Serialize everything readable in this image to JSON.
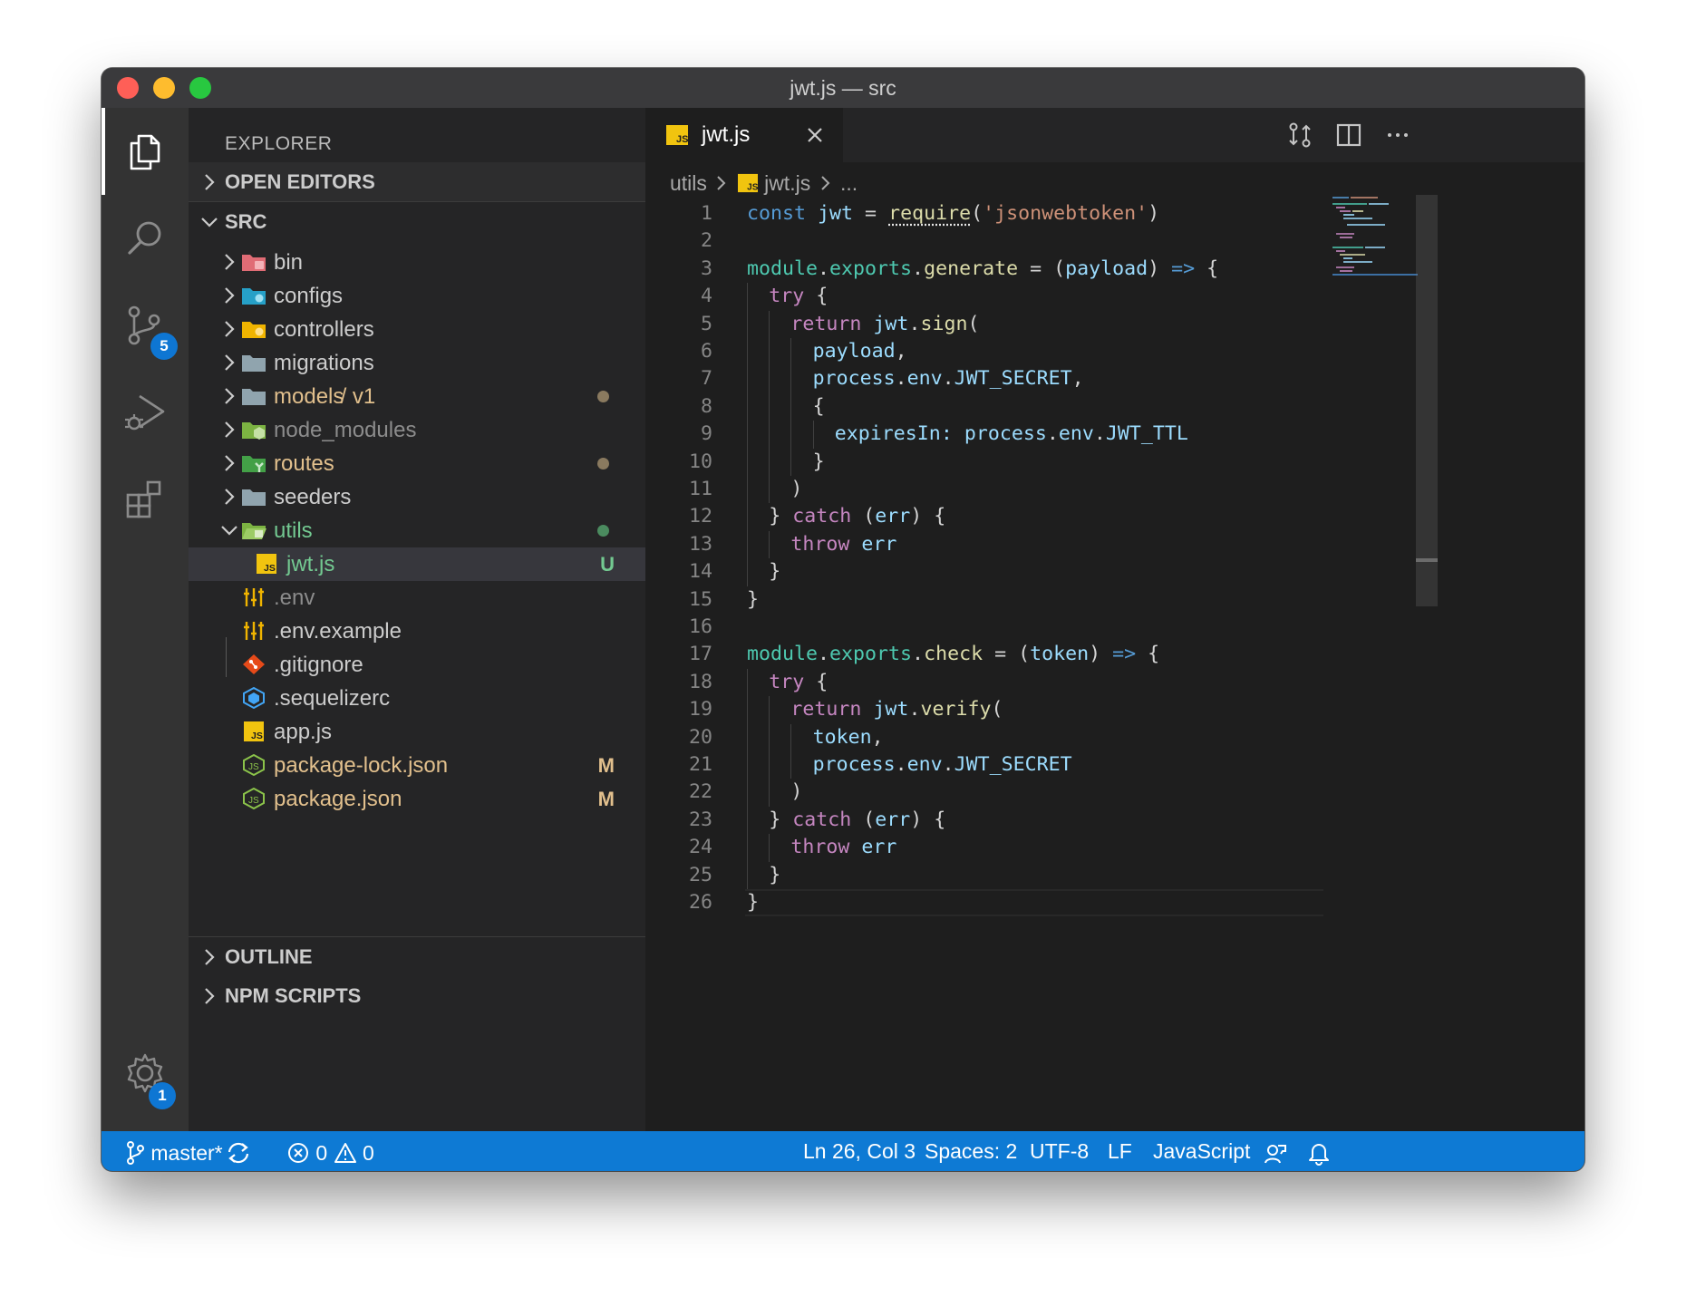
{
  "window": {
    "title": "jwt.js — src"
  },
  "activity_bar": {
    "items": [
      {
        "name": "explorer",
        "icon": "files-icon",
        "active": true
      },
      {
        "name": "search",
        "icon": "search-icon"
      },
      {
        "name": "source-control",
        "icon": "source-control-icon",
        "badge": "5"
      },
      {
        "name": "run-debug",
        "icon": "run-debug-icon"
      },
      {
        "name": "extensions",
        "icon": "extensions-icon"
      }
    ],
    "manage": {
      "icon": "gear-icon",
      "badge": "1"
    }
  },
  "sidebar": {
    "title": "EXPLORER",
    "sections": {
      "open_editors": "OPEN EDITORS",
      "src": "SRC",
      "outline": "OUTLINE",
      "npm_scripts": "NPM SCRIPTS"
    },
    "tree": [
      {
        "name": "bin",
        "kind": "folder",
        "icon": "folder-bin-icon",
        "color": "#cccccc"
      },
      {
        "name": "configs",
        "kind": "folder",
        "icon": "folder-config-icon",
        "color": "#cccccc"
      },
      {
        "name": "controllers",
        "kind": "folder",
        "icon": "folder-controller-icon",
        "color": "#cccccc"
      },
      {
        "name": "migrations",
        "kind": "folder",
        "icon": "folder-icon",
        "color": "#cccccc"
      },
      {
        "name": "models",
        "suffix": " / v1",
        "kind": "folder",
        "icon": "folder-icon",
        "color": "#e2c08d",
        "dot": "#8a7a5f"
      },
      {
        "name": "node_modules",
        "kind": "folder",
        "icon": "folder-node-icon",
        "color": "#8c8c8c"
      },
      {
        "name": "routes",
        "kind": "folder",
        "icon": "folder-routes-icon",
        "color": "#e2c08d",
        "dot": "#8a7a5f"
      },
      {
        "name": "seeders",
        "kind": "folder",
        "icon": "folder-icon",
        "color": "#cccccc"
      },
      {
        "name": "utils",
        "kind": "folder-open",
        "icon": "folder-utils-icon",
        "color": "#73c991",
        "dot": "#4b8b5f"
      },
      {
        "name": "jwt.js",
        "kind": "file",
        "icon": "js-file-icon",
        "color": "#73c991",
        "deco": "U",
        "deco_color": "#73c991",
        "selected": true
      },
      {
        "name": ".env",
        "kind": "file",
        "icon": "env-file-icon",
        "color": "#8c8c8c"
      },
      {
        "name": ".env.example",
        "kind": "file",
        "icon": "env-file-icon",
        "color": "#cccccc"
      },
      {
        "name": ".gitignore",
        "kind": "file",
        "icon": "git-file-icon",
        "color": "#cccccc"
      },
      {
        "name": ".sequelizerc",
        "kind": "file",
        "icon": "sequelize-file-icon",
        "color": "#cccccc"
      },
      {
        "name": "app.js",
        "kind": "file",
        "icon": "js-file-icon",
        "color": "#cccccc"
      },
      {
        "name": "package-lock.json",
        "kind": "file",
        "icon": "node-file-icon",
        "color": "#e2c08d",
        "deco": "M",
        "deco_color": "#e2c08d"
      },
      {
        "name": "package.json",
        "kind": "file",
        "icon": "node-file-icon",
        "color": "#e2c08d",
        "deco": "M",
        "deco_color": "#e2c08d"
      }
    ]
  },
  "editor": {
    "tab": {
      "label": "jwt.js",
      "icon": "js-file-icon",
      "close_icon": "close-icon"
    },
    "actions": [
      {
        "name": "open-changes",
        "icon": "compare-changes-icon"
      },
      {
        "name": "split-editor",
        "icon": "split-editor-icon"
      },
      {
        "name": "more-actions",
        "icon": "ellipsis-icon"
      }
    ],
    "breadcrumb": {
      "folder": "utils",
      "file": "jwt.js",
      "more": "..."
    },
    "cursor_line": 26,
    "lines": [
      {
        "n": "1",
        "indent": 0,
        "tokens": [
          [
            "kw",
            "const"
          ],
          [
            "pun",
            " "
          ],
          [
            "var",
            "jwt"
          ],
          [
            "pun",
            " = "
          ],
          [
            "fnw",
            "require"
          ],
          [
            "pun",
            "("
          ],
          [
            "str",
            "'jsonwebtoken'"
          ],
          [
            "pun",
            ")"
          ]
        ]
      },
      {
        "n": "2",
        "indent": 0,
        "tokens": []
      },
      {
        "n": "3",
        "indent": 0,
        "tokens": [
          [
            "obj",
            "module"
          ],
          [
            "pun",
            "."
          ],
          [
            "obj",
            "exports"
          ],
          [
            "pun",
            "."
          ],
          [
            "fn",
            "generate"
          ],
          [
            "pun",
            " = ("
          ],
          [
            "var",
            "payload"
          ],
          [
            "pun",
            ") "
          ],
          [
            "kw",
            "=>"
          ],
          [
            "pun",
            " {"
          ]
        ]
      },
      {
        "n": "4",
        "indent": 1,
        "tokens": [
          [
            "ctl",
            "try"
          ],
          [
            "pun",
            " {"
          ]
        ]
      },
      {
        "n": "5",
        "indent": 2,
        "tokens": [
          [
            "ctl",
            "return"
          ],
          [
            "pun",
            " "
          ],
          [
            "var",
            "jwt"
          ],
          [
            "pun",
            "."
          ],
          [
            "fn",
            "sign"
          ],
          [
            "pun",
            "("
          ]
        ]
      },
      {
        "n": "6",
        "indent": 3,
        "tokens": [
          [
            "var",
            "payload"
          ],
          [
            "pun",
            ","
          ]
        ]
      },
      {
        "n": "7",
        "indent": 3,
        "tokens": [
          [
            "var",
            "process"
          ],
          [
            "pun",
            "."
          ],
          [
            "var",
            "env"
          ],
          [
            "pun",
            "."
          ],
          [
            "var",
            "JWT_SECRET"
          ],
          [
            "pun",
            ","
          ]
        ]
      },
      {
        "n": "8",
        "indent": 3,
        "tokens": [
          [
            "pun",
            "{"
          ]
        ]
      },
      {
        "n": "9",
        "indent": 4,
        "tokens": [
          [
            "var",
            "expiresIn"
          ],
          [
            "var",
            ":"
          ],
          [
            "pun",
            " "
          ],
          [
            "var",
            "process"
          ],
          [
            "pun",
            "."
          ],
          [
            "var",
            "env"
          ],
          [
            "pun",
            "."
          ],
          [
            "var",
            "JWT_TTL"
          ]
        ]
      },
      {
        "n": "10",
        "indent": 3,
        "tokens": [
          [
            "pun",
            "}"
          ]
        ]
      },
      {
        "n": "11",
        "indent": 2,
        "tokens": [
          [
            "pun",
            ")"
          ]
        ]
      },
      {
        "n": "12",
        "indent": 1,
        "tokens": [
          [
            "pun",
            "} "
          ],
          [
            "ctl",
            "catch"
          ],
          [
            "pun",
            " ("
          ],
          [
            "var",
            "err"
          ],
          [
            "pun",
            ") {"
          ]
        ]
      },
      {
        "n": "13",
        "indent": 2,
        "tokens": [
          [
            "ctl",
            "throw"
          ],
          [
            "pun",
            " "
          ],
          [
            "var",
            "err"
          ]
        ]
      },
      {
        "n": "14",
        "indent": 1,
        "tokens": [
          [
            "pun",
            "}"
          ]
        ]
      },
      {
        "n": "15",
        "indent": 0,
        "tokens": [
          [
            "pun",
            "}"
          ]
        ]
      },
      {
        "n": "16",
        "indent": 0,
        "tokens": []
      },
      {
        "n": "17",
        "indent": 0,
        "tokens": [
          [
            "obj",
            "module"
          ],
          [
            "pun",
            "."
          ],
          [
            "obj",
            "exports"
          ],
          [
            "pun",
            "."
          ],
          [
            "fn",
            "check"
          ],
          [
            "pun",
            " = ("
          ],
          [
            "var",
            "token"
          ],
          [
            "pun",
            ") "
          ],
          [
            "kw",
            "=>"
          ],
          [
            "pun",
            " {"
          ]
        ]
      },
      {
        "n": "18",
        "indent": 1,
        "tokens": [
          [
            "ctl",
            "try"
          ],
          [
            "pun",
            " {"
          ]
        ]
      },
      {
        "n": "19",
        "indent": 2,
        "tokens": [
          [
            "ctl",
            "return"
          ],
          [
            "pun",
            " "
          ],
          [
            "var",
            "jwt"
          ],
          [
            "pun",
            "."
          ],
          [
            "fn",
            "verify"
          ],
          [
            "pun",
            "("
          ]
        ]
      },
      {
        "n": "20",
        "indent": 3,
        "tokens": [
          [
            "var",
            "token"
          ],
          [
            "pun",
            ","
          ]
        ]
      },
      {
        "n": "21",
        "indent": 3,
        "tokens": [
          [
            "var",
            "process"
          ],
          [
            "pun",
            "."
          ],
          [
            "var",
            "env"
          ],
          [
            "pun",
            "."
          ],
          [
            "var",
            "JWT_SECRET"
          ]
        ]
      },
      {
        "n": "22",
        "indent": 2,
        "tokens": [
          [
            "pun",
            ")"
          ]
        ]
      },
      {
        "n": "23",
        "indent": 1,
        "tokens": [
          [
            "pun",
            "} "
          ],
          [
            "ctl",
            "catch"
          ],
          [
            "pun",
            " ("
          ],
          [
            "var",
            "err"
          ],
          [
            "pun",
            ") {"
          ]
        ]
      },
      {
        "n": "24",
        "indent": 2,
        "tokens": [
          [
            "ctl",
            "throw"
          ],
          [
            "pun",
            " "
          ],
          [
            "var",
            "err"
          ]
        ]
      },
      {
        "n": "25",
        "indent": 1,
        "tokens": [
          [
            "pun",
            "}"
          ]
        ]
      },
      {
        "n": "26",
        "indent": 0,
        "tokens": [
          [
            "pun",
            "}"
          ]
        ]
      }
    ]
  },
  "status_bar": {
    "branch": "master*",
    "branch_icon": "git-branch-icon",
    "sync_icon": "sync-icon",
    "errors": "0",
    "warnings": "0",
    "position": "Ln 26, Col 3",
    "spaces": "Spaces: 2",
    "encoding": "UTF-8",
    "eol": "LF",
    "language": "JavaScript",
    "feedback_icon": "feedback-icon",
    "bell_icon": "bell-icon"
  },
  "colors": {
    "accent": "#0e7ad4",
    "untracked": "#73c991",
    "modified": "#e2c08d"
  }
}
